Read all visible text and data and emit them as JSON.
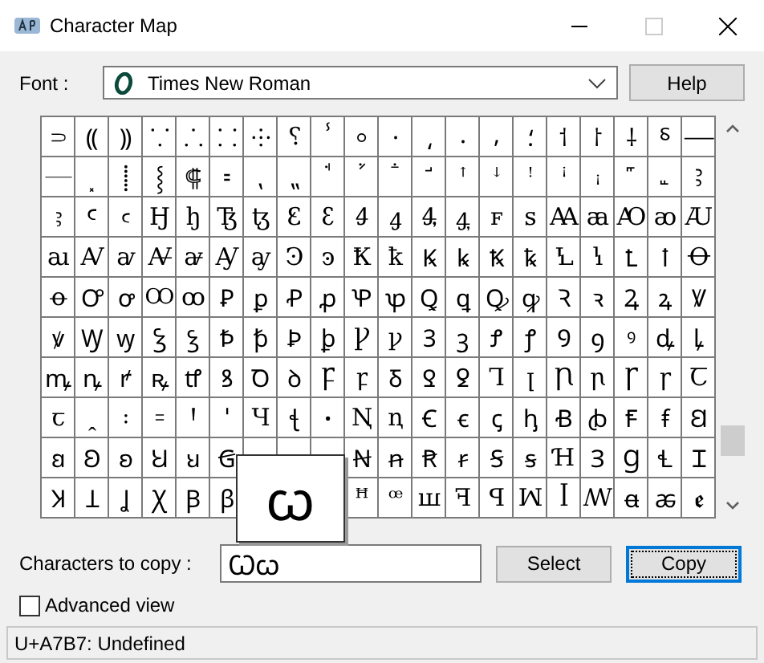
{
  "window": {
    "title": "Character Map"
  },
  "font": {
    "label": "Font :",
    "value": "Times New Roman"
  },
  "help_button": {
    "label": "Help"
  },
  "grid": {
    "rows": [
      [
        "⸧",
        "⸨",
        "⸩",
        "⸪",
        "⸫",
        "⸬",
        "⸭",
        "⸮",
        "ⸯ",
        "⸰",
        "⸱",
        "⸲",
        "⸳",
        "⸴",
        "⸵",
        "⸶",
        "⸷",
        "⸸",
        "⸹",
        "⸺"
      ],
      [
        "⸻",
        "⸼",
        "⸽",
        "⸾",
        "⸿",
        "⹀",
        "⹁",
        "⹂",
        "ꜗ",
        "ꜘ",
        "ꜙ",
        "ꜚ",
        "ꜛ",
        "ꜜ",
        "ꜝ",
        "ꜞ",
        "ꜟ",
        "꜠",
        "꜡",
        "Ꜣ"
      ],
      [
        "ꜣ",
        "Ꜥ",
        "ꜥ",
        "Ꜧ",
        "ꜧ",
        "Ꜩ",
        "ꜩ",
        "Ꜫ",
        "ꜫ",
        "Ꜭ",
        "ꜭ",
        "Ꜯ",
        "ꜯ",
        "ꜰ",
        "ꜱ",
        "Ꜳ",
        "ꜳ",
        "Ꜵ",
        "ꜵ",
        "Ꜷ"
      ],
      [
        "ꜷ",
        "Ꜹ",
        "ꜹ",
        "Ꜻ",
        "ꜻ",
        "Ꜽ",
        "ꜽ",
        "Ꜿ",
        "ꜿ",
        "Ꝁ",
        "ꝁ",
        "Ꝃ",
        "ꝃ",
        "Ꝅ",
        "ꝅ",
        "Ꝇ",
        "ꝇ",
        "Ꝉ",
        "ꝉ",
        "Ꝋ"
      ],
      [
        "ꝋ",
        "Ꝍ",
        "ꝍ",
        "Ꝏ",
        "ꝏ",
        "Ꝑ",
        "ꝑ",
        "Ꝓ",
        "ꝓ",
        "Ꝕ",
        "ꝕ",
        "Ꝗ",
        "ꝗ",
        "Ꝙ",
        "ꝙ",
        "Ꝛ",
        "ꝛ",
        "Ꝝ",
        "ꝝ",
        "Ꝟ"
      ],
      [
        "ꝟ",
        "Ꝡ",
        "ꝡ",
        "Ꝣ",
        "ꝣ",
        "Ꝥ",
        "ꝥ",
        "Ꝧ",
        "ꝧ",
        "Ꝩ",
        "ꝩ",
        "Ꝫ",
        "ꝫ",
        "Ꝭ",
        "ꝭ",
        "Ꝯ",
        "ꝯ",
        "ꝰ",
        "ꝱ",
        "ꝲ"
      ],
      [
        "ꝳ",
        "ꝴ",
        "ꝵ",
        "ꝶ",
        "ꝷ",
        "ꝸ",
        "Ꝺ",
        "ꝺ",
        "Ꝼ",
        "ꝼ",
        "Ᵹ",
        "Ꝿ",
        "ꝿ",
        "Ꞁ",
        "ꞁ",
        "Ꞃ",
        "ꞃ",
        "Ꞅ",
        "ꞅ",
        "Ꞇ"
      ],
      [
        "ꞇ",
        "ꞈ",
        "꞉",
        "꞊",
        "Ꞌ",
        "ꞌ",
        "Ɥ",
        "ꞎ",
        "ꞏ",
        "Ꞑ",
        "ꞑ",
        "Ꞓ",
        "ꞓ",
        "ꞔ",
        "ꞕ",
        "Ꞗ",
        "ꞗ",
        "Ꞙ",
        "ꞙ",
        "Ꞛ"
      ],
      [
        "ꞛ",
        "Ꞝ",
        "ꞝ",
        "Ꞟ",
        "ꞟ",
        "Ꞡ",
        null,
        null,
        null,
        "Ꞥ",
        "ꞥ",
        "Ꞧ",
        "ꞧ",
        "Ꞩ",
        "ꞩ",
        "Ɦ",
        "Ɜ",
        "Ɡ",
        "Ɬ",
        "Ɪ"
      ],
      [
        "Ʞ",
        "Ʇ",
        "Ʝ",
        "Ꭓ",
        "Ꞵ",
        "ꞵ",
        null,
        null,
        null,
        "ꟸ",
        "ꟹ",
        "ꟺ",
        "ꟻ",
        "ꟼ",
        "ꟽ",
        "ꟾ",
        "ꟿ",
        "ꬰ",
        "ꬱ",
        "ꬲ"
      ]
    ],
    "preview": "ꞷ"
  },
  "copy": {
    "label": "Characters to copy :",
    "value": "Ꞷꞷ"
  },
  "buttons": [
    {
      "label": "Select",
      "default": false
    },
    {
      "label": "Copy",
      "default": true
    }
  ],
  "advanced_view": {
    "label": "Advanced view",
    "checked": false
  },
  "status_bar": "U+A7B7: Undefined"
}
